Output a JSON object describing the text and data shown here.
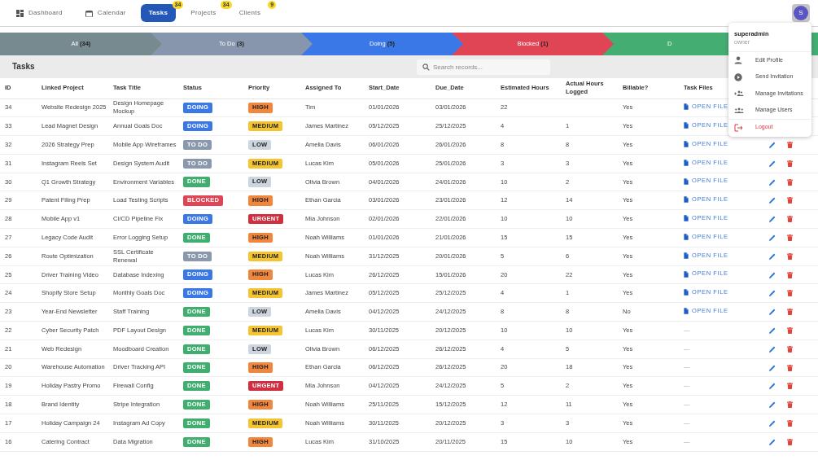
{
  "nav": [
    {
      "label": "Dashboard",
      "selected": false
    },
    {
      "label": "Calendar",
      "selected": false
    },
    {
      "label": "Tasks",
      "selected": true,
      "badge": "34"
    },
    {
      "label": "Projects",
      "selected": false,
      "badge": "34"
    },
    {
      "label": "Clients",
      "selected": false,
      "badge": "9"
    }
  ],
  "user": {
    "initial": "S"
  },
  "stages": [
    {
      "label": "All **(34)**",
      "color": "#778a8f"
    },
    {
      "label": "To Do **(3)**",
      "color": "#8796ad"
    },
    {
      "label": "Doing **(5)**",
      "color": "#3b78e7"
    },
    {
      "label": "Blocked **(1)**",
      "color": "#e04556"
    },
    {
      "label": "D",
      "color": "#44ad72"
    }
  ],
  "page_title": "Tasks",
  "search": {
    "placeholder": "Search records..."
  },
  "table": {
    "columns": [
      "ID",
      "Linked Project",
      "Task Title",
      "Status",
      "Priority",
      "Assigned To",
      "Start_Date",
      "Due_Date",
      "Estimated Hours",
      "Actual Hours Logged",
      "Billable?",
      "Task Files"
    ],
    "rows": [
      {
        "id": "34",
        "project": "Website Redesign 2025",
        "title": "Design Homepage Mockup",
        "status": {
          "kind": "doing",
          "label": "DOING"
        },
        "priority": {
          "kind": "high",
          "label": "HIGH"
        },
        "assigned": "Tim",
        "start": "01/01/2026",
        "due": "03/01/2026",
        "estimated": "22",
        "billable": "Yes",
        "file": {
          "kind": "link",
          "label": "OPEN FILE"
        }
      },
      {
        "id": "33",
        "project": "Lead Magnet Design",
        "title": "Annual Goals Doc",
        "status": {
          "kind": "doing",
          "label": "DOING"
        },
        "priority": {
          "kind": "medium",
          "label": "MEDIUM"
        },
        "assigned": "James Martinez",
        "start": "05/12/2025",
        "due": "25/12/2025",
        "estimated": "4",
        "actual": "1",
        "billable": "Yes",
        "file": {
          "kind": "link",
          "label": "OPEN FILE"
        }
      },
      {
        "id": "32",
        "project": "2026 Strategy Prep",
        "title": "Mobile App Wireframes",
        "status": {
          "kind": "todo",
          "label": "TO DO"
        },
        "priority": {
          "kind": "low",
          "label": "LOW"
        },
        "assigned": "Amelia Davis",
        "start": "06/01/2026",
        "due": "26/01/2026",
        "estimated": "8",
        "actual": "8",
        "billable": "Yes",
        "file": {
          "kind": "link",
          "label": "OPEN FILE"
        }
      },
      {
        "id": "31",
        "project": "Instagram Reels Set",
        "title": "Design System Audit",
        "status": {
          "kind": "todo",
          "label": "TO DO"
        },
        "priority": {
          "kind": "medium",
          "label": "MEDIUM"
        },
        "assigned": "Lucas Kim",
        "start": "05/01/2026",
        "due": "25/01/2026",
        "estimated": "3",
        "actual": "3",
        "billable": "Yes",
        "file": {
          "kind": "link",
          "label": "OPEN FILE"
        }
      },
      {
        "id": "30",
        "project": "Q1 Growth Strategy",
        "title": "Environment Variables",
        "status": {
          "kind": "done",
          "label": "DONE"
        },
        "priority": {
          "kind": "low",
          "label": "LOW"
        },
        "assigned": "Olivia Brown",
        "start": "04/01/2026",
        "due": "24/01/2026",
        "estimated": "10",
        "actual": "2",
        "billable": "Yes",
        "file": {
          "kind": "link",
          "label": "OPEN FILE"
        }
      },
      {
        "id": "29",
        "project": "Patent Filing Prep",
        "title": "Load Testing Scripts",
        "status": {
          "kind": "blocked",
          "label": "BLOCKED"
        },
        "priority": {
          "kind": "high",
          "label": "HIGH"
        },
        "assigned": "Ethan Garcia",
        "start": "03/01/2026",
        "due": "23/01/2026",
        "estimated": "12",
        "actual": "14",
        "billable": "Yes",
        "file": {
          "kind": "link",
          "label": "OPEN FILE"
        }
      },
      {
        "id": "28",
        "project": "Mobile App v1",
        "title": "CI/CD Pipeline Fix",
        "status": {
          "kind": "doing",
          "label": "DOING"
        },
        "priority": {
          "kind": "urgent",
          "label": "URGENT"
        },
        "assigned": "Mia Johnson",
        "start": "02/01/2026",
        "due": "22/01/2026",
        "estimated": "10",
        "actual": "10",
        "billable": "Yes",
        "file": {
          "kind": "link",
          "label": "OPEN FILE"
        }
      },
      {
        "id": "27",
        "project": "Legacy Code Audit",
        "title": "Error Logging Setup",
        "status": {
          "kind": "done",
          "label": "DONE"
        },
        "priority": {
          "kind": "high",
          "label": "HIGH"
        },
        "assigned": "Noah Williams",
        "start": "01/01/2026",
        "due": "21/01/2026",
        "estimated": "15",
        "actual": "15",
        "billable": "Yes",
        "file": {
          "kind": "link",
          "label": "OPEN FILE"
        }
      },
      {
        "id": "26",
        "project": "Route Optimization",
        "title": "SSL Certificate Renewal",
        "status": {
          "kind": "todo",
          "label": "TO DO"
        },
        "priority": {
          "kind": "medium",
          "label": "MEDIUM"
        },
        "assigned": "Noah Williams",
        "start": "31/12/2025",
        "due": "20/01/2026",
        "estimated": "5",
        "actual": "6",
        "billable": "Yes",
        "file": {
          "kind": "link",
          "label": "OPEN FILE"
        }
      },
      {
        "id": "25",
        "project": "Driver Training Video",
        "title": "Database Indexing",
        "status": {
          "kind": "doing",
          "label": "DOING"
        },
        "priority": {
          "kind": "high",
          "label": "HIGH"
        },
        "assigned": "Lucas Kim",
        "start": "26/12/2025",
        "due": "15/01/2026",
        "estimated": "20",
        "actual": "22",
        "billable": "Yes",
        "file": {
          "kind": "link",
          "label": "OPEN FILE"
        }
      },
      {
        "id": "24",
        "project": "Shopify Store Setup",
        "title": "Monthly Goals Doc",
        "status": {
          "kind": "doing",
          "label": "DOING"
        },
        "priority": {
          "kind": "medium",
          "label": "MEDIUM"
        },
        "assigned": "James Martinez",
        "start": "05/12/2025",
        "due": "25/12/2025",
        "estimated": "4",
        "actual": "1",
        "billable": "Yes",
        "file": {
          "kind": "link",
          "label": "OPEN FILE"
        }
      },
      {
        "id": "23",
        "project": "Year-End Newsletter",
        "title": "Staff Training",
        "status": {
          "kind": "done",
          "label": "DONE"
        },
        "priority": {
          "kind": "low",
          "label": "LOW"
        },
        "assigned": "Amelia Davis",
        "start": "04/12/2025",
        "due": "24/12/2025",
        "estimated": "8",
        "actual": "8",
        "billable": "No",
        "file": {
          "kind": "link",
          "label": "OPEN FILE"
        }
      },
      {
        "id": "22",
        "project": "Cyber Security Patch",
        "title": "PDF Layout Design",
        "status": {
          "kind": "done",
          "label": "DONE"
        },
        "priority": {
          "kind": "medium",
          "label": "MEDIUM"
        },
        "assigned": "Lucas Kim",
        "start": "30/11/2025",
        "due": "20/12/2025",
        "estimated": "10",
        "actual": "10",
        "billable": "Yes",
        "file": {
          "kind": "none",
          "label": "—"
        }
      },
      {
        "id": "21",
        "project": "Web Redesign",
        "title": "Moodboard Creation",
        "status": {
          "kind": "done",
          "label": "DONE"
        },
        "priority": {
          "kind": "low",
          "label": "LOW"
        },
        "assigned": "Olivia Brown",
        "start": "06/12/2025",
        "due": "26/12/2025",
        "estimated": "4",
        "actual": "5",
        "billable": "Yes",
        "file": {
          "kind": "none",
          "label": "—"
        }
      },
      {
        "id": "20",
        "project": "Warehouse Automation",
        "title": "Driver Tracking API",
        "status": {
          "kind": "done",
          "label": "DONE"
        },
        "priority": {
          "kind": "high",
          "label": "HIGH"
        },
        "assigned": "Ethan Garcia",
        "start": "06/12/2025",
        "due": "26/12/2025",
        "estimated": "20",
        "actual": "18",
        "billable": "Yes",
        "file": {
          "kind": "none",
          "label": "—"
        }
      },
      {
        "id": "19",
        "project": "Holiday Pastry Promo",
        "title": "Firewall Config",
        "status": {
          "kind": "done",
          "label": "DONE"
        },
        "priority": {
          "kind": "urgent",
          "label": "URGENT"
        },
        "assigned": "Mia Johnson",
        "start": "04/12/2025",
        "due": "24/12/2025",
        "estimated": "5",
        "actual": "2",
        "billable": "Yes",
        "file": {
          "kind": "none",
          "label": "—"
        }
      },
      {
        "id": "18",
        "project": "Brand Identity",
        "title": "Stripe Integration",
        "status": {
          "kind": "done",
          "label": "DONE"
        },
        "priority": {
          "kind": "high",
          "label": "HIGH"
        },
        "assigned": "Noah Williams",
        "start": "25/11/2025",
        "due": "15/12/2025",
        "estimated": "12",
        "actual": "11",
        "billable": "Yes",
        "file": {
          "kind": "none",
          "label": "—"
        }
      },
      {
        "id": "17",
        "project": "Holiday Campaign 24",
        "title": "Instagram Ad Copy",
        "status": {
          "kind": "done",
          "label": "DONE"
        },
        "priority": {
          "kind": "medium",
          "label": "MEDIUM"
        },
        "assigned": "Noah Williams",
        "start": "30/11/2025",
        "due": "20/12/2025",
        "estimated": "3",
        "actual": "3",
        "billable": "Yes",
        "file": {
          "kind": "none",
          "label": "—"
        }
      },
      {
        "id": "16",
        "project": "Catering Contract",
        "title": "Data Migration",
        "status": {
          "kind": "done",
          "label": "DONE"
        },
        "priority": {
          "kind": "high",
          "label": "HIGH"
        },
        "assigned": "Lucas Kim",
        "start": "31/10/2025",
        "due": "20/11/2025",
        "estimated": "15",
        "actual": "10",
        "billable": "Yes",
        "file": {
          "kind": "none",
          "label": "—"
        }
      }
    ]
  },
  "user_menu": {
    "name": "superadmin",
    "role": "owner",
    "items": [
      {
        "label": "Edit Profile",
        "kind": "normal"
      },
      {
        "label": "Send Invitation",
        "kind": "normal"
      },
      {
        "label": "Manage Invitations",
        "kind": "normal"
      },
      {
        "label": "Manage Users",
        "kind": "normal"
      },
      {
        "label": "Logout",
        "kind": "danger"
      }
    ]
  }
}
